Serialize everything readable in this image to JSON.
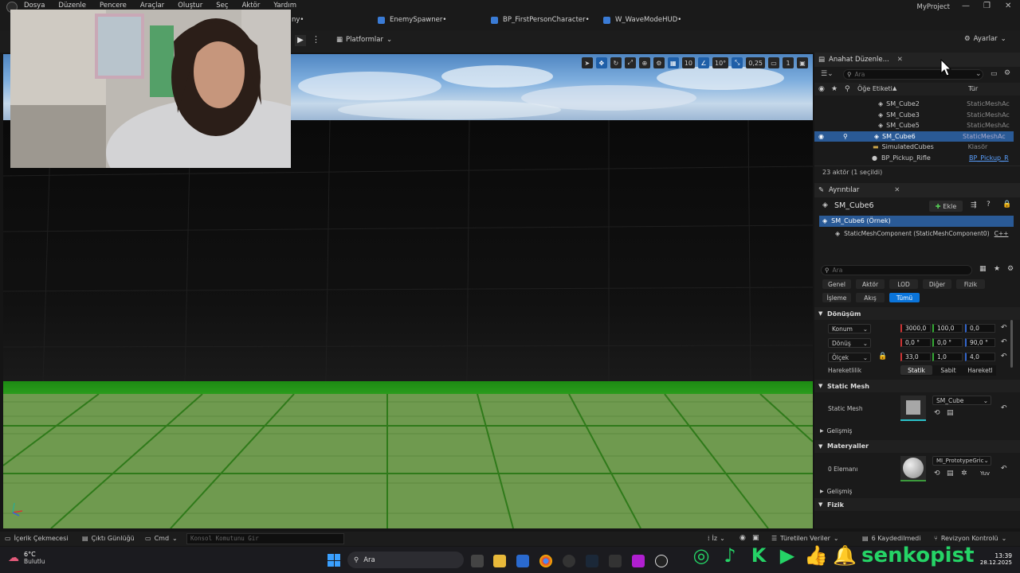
{
  "menu": [
    "Dosya",
    "Düzenle",
    "Pencere",
    "Araçlar",
    "Oluştur",
    "Seç",
    "Aktör",
    "Yardım"
  ],
  "doc_tabs": [
    {
      "label": "ny•",
      "color": "#9a9a9a"
    },
    {
      "label": "EnemySpawner•",
      "color": "#3a7bd5"
    },
    {
      "label": "BP_FirstPersonCharacter•",
      "color": "#3a7bd5"
    },
    {
      "label": "W_WaveModeHUD•",
      "color": "#3a7bd5"
    }
  ],
  "project_name": "MyProject",
  "toolbar": {
    "platforms": "Platformlar",
    "settings": "Ayarlar"
  },
  "viewport_tools": {
    "grid": "10",
    "rotation": "10°",
    "scale": "0,25",
    "camera": "1"
  },
  "outliner": {
    "tab": "Anahat Düzenle...",
    "search_placeholder": "Ara",
    "col_label": "Öğe Etiketi",
    "col_type": "Tür",
    "rows": [
      {
        "name": "SM_Cube2",
        "type": "StaticMeshAc"
      },
      {
        "name": "SM_Cube3",
        "type": "StaticMeshAc"
      },
      {
        "name": "SM_Cube5",
        "type": "StaticMeshAc"
      },
      {
        "name": "SM_Cube6",
        "type": "StaticMeshAc"
      },
      {
        "name": "SimulatedCubes",
        "type": "Klasör"
      },
      {
        "name": "BP_Pickup_Rifle",
        "type": "BP_Pickup_R"
      }
    ],
    "footer": "23 aktör (1 seçildi)"
  },
  "details": {
    "tab": "Ayrıntılar",
    "actor_name": "SM_Cube6",
    "add_label": "Ekle",
    "instance": "SM_Cube6 (Örnek)",
    "component": "StaticMeshComponent (StaticMeshComponent0)",
    "component_tag": "C++",
    "search_placeholder": "Ara",
    "filters_row1": [
      "Genel",
      "Aktör",
      "LOD",
      "Diğer",
      "Fizik"
    ],
    "filters_row2": [
      "İşleme",
      "Akış",
      "Tümü"
    ],
    "transform_title": "Dönüşüm",
    "transform": [
      {
        "label": "Konum",
        "x": "3000,0",
        "y": "100,0",
        "z": "0,0"
      },
      {
        "label": "Dönüş",
        "x": "0,0 °",
        "y": "0,0 °",
        "z": "90,0 °"
      },
      {
        "label": "Ölçek",
        "x": "33,0",
        "y": "1,0",
        "z": "4,0"
      }
    ],
    "mobility_label": "Hareketlilik",
    "mobility": [
      "Statik",
      "Sabit",
      "Hareketl"
    ],
    "static_mesh_title": "Static Mesh",
    "static_mesh_label": "Static Mesh",
    "static_mesh_value": "SM_Cube",
    "advanced": "Gelişmiş",
    "materials_title": "Materyaller",
    "materials_label": "0 Elemanı",
    "material_value": "MI_PrototypeGric",
    "material_extra": "Yuv",
    "advanced2": "Gelişmiş",
    "physics_title": "Fizik"
  },
  "statusbar": {
    "content_drawer": "İçerik Çekmecesi",
    "output_log": "Çıktı Günlüğü",
    "cmd": "Cmd",
    "console_placeholder": "Konsol Komutunu Gir",
    "iz": "İz",
    "derived": "Türetilen Veriler",
    "saved": "6 Kaydedilmedi",
    "revision": "Revizyon Kontrolü"
  },
  "taskbar": {
    "temp": "6°C",
    "weather": "Bulutlu",
    "search": "Ara",
    "time": "13:39",
    "date": "28.12.2025"
  },
  "overlay": {
    "brand": "senkopist"
  }
}
